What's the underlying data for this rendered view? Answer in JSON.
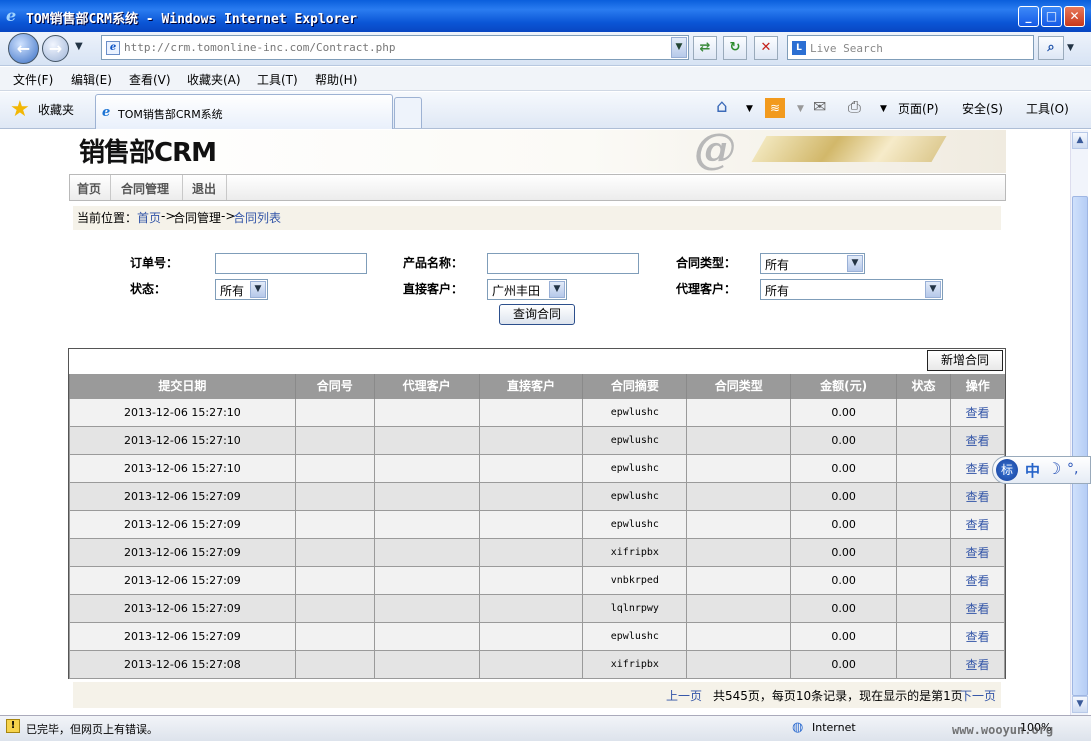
{
  "window": {
    "title": "TOM销售部CRM系统 - Windows Internet Explorer",
    "min": "_",
    "max": "□",
    "close": "✕"
  },
  "browser": {
    "url": "http://crm.tomonline-inc.com/Contract.php",
    "search_placeholder": "Live Search",
    "menus": [
      "文件(F)",
      "编辑(E)",
      "查看(V)",
      "收藏夹(A)",
      "工具(T)",
      "帮助(H)"
    ],
    "favorites": "收藏夹",
    "tab_title": "TOM销售部CRM系统",
    "toolbar": {
      "page": "页面(P)",
      "safety": "安全(S)",
      "tools": "工具(O)"
    },
    "status": "已完毕，但网页上有错误。",
    "zone": "Internet",
    "zoom": "100%"
  },
  "page": {
    "logo": "销售部CRM",
    "nav": [
      "首页",
      "合同管理",
      "退出"
    ],
    "breadcrumb": {
      "label": "当前位置：",
      "home": "首页",
      "arrow1": "->",
      "mid": "合同管理",
      "arrow2": "->",
      "current": "合同列表"
    },
    "filters": {
      "order_label": "订单号：",
      "product_label": "产品名称：",
      "type_label": "合同类型：",
      "type_value": "所有",
      "status_label": "状态：",
      "status_value": "所有",
      "direct_label": "直接客户：",
      "direct_value": "广州丰田",
      "agent_label": "代理客户：",
      "agent_value": "所有",
      "query_button": "查询合同"
    },
    "add_button": "新增合同",
    "columns": [
      "提交日期",
      "合同号",
      "代理客户",
      "直接客户",
      "合同摘要",
      "合同类型",
      "金额(元)",
      "状态",
      "操作"
    ],
    "rows": [
      {
        "date": "2013-12-06 15:27:10",
        "summary": "epwlushc",
        "amount": "0.00",
        "action": "查看"
      },
      {
        "date": "2013-12-06 15:27:10",
        "summary": "epwlushc",
        "amount": "0.00",
        "action": "查看"
      },
      {
        "date": "2013-12-06 15:27:10",
        "summary": "epwlushc",
        "amount": "0.00",
        "action": "查看"
      },
      {
        "date": "2013-12-06 15:27:09",
        "summary": "epwlushc",
        "amount": "0.00",
        "action": "查看"
      },
      {
        "date": "2013-12-06 15:27:09",
        "summary": "epwlushc",
        "amount": "0.00",
        "action": "查看"
      },
      {
        "date": "2013-12-06 15:27:09",
        "summary": "xifripbx",
        "amount": "0.00",
        "action": "查看"
      },
      {
        "date": "2013-12-06 15:27:09",
        "summary": "vnbkrped",
        "amount": "0.00",
        "action": "查看"
      },
      {
        "date": "2013-12-06 15:27:09",
        "summary": "lqlnrpwy",
        "amount": "0.00",
        "action": "查看"
      },
      {
        "date": "2013-12-06 15:27:09",
        "summary": "epwlushc",
        "amount": "0.00",
        "action": "查看"
      },
      {
        "date": "2013-12-06 15:27:08",
        "summary": "xifripbx",
        "amount": "0.00",
        "action": "查看"
      }
    ],
    "pager": {
      "prev": "上一页",
      "info": "共545页，每页10条记录，现在显示的是第1页",
      "next": "下一页"
    }
  },
  "ime": {
    "badge": "标",
    "lang": "中",
    "moon": "☽",
    "punct": "°,"
  },
  "watermark": "www.wooyun.org"
}
